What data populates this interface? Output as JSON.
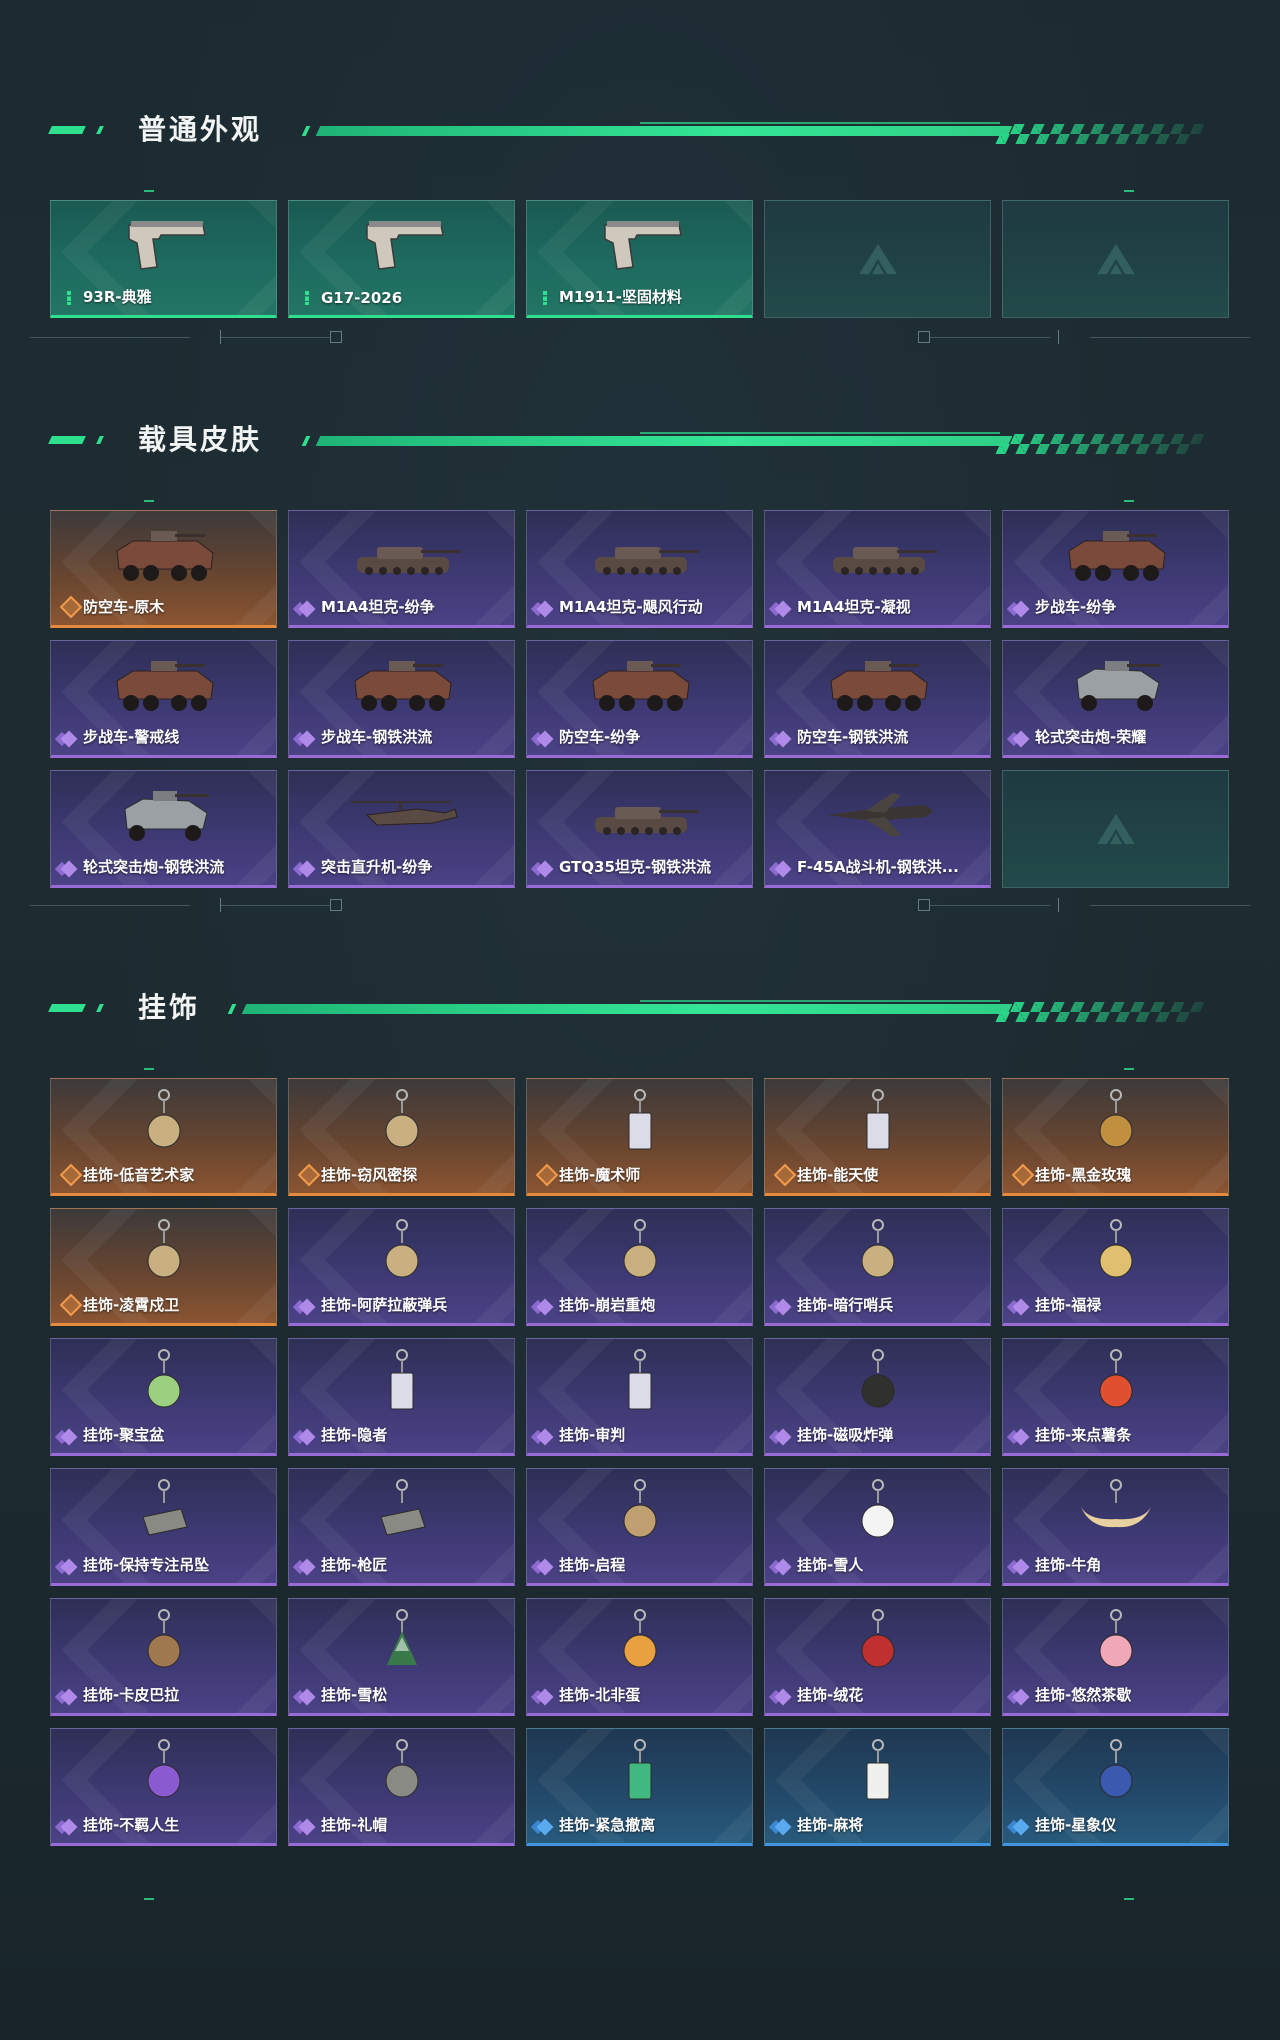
{
  "sections": [
    {
      "title": "普通外观",
      "cards": [
        {
          "label": "93R-典雅",
          "rarity": "green",
          "icon": "pistol-icon"
        },
        {
          "label": "G17-2026",
          "rarity": "green",
          "icon": "pistol-icon"
        },
        {
          "label": "M1911-坚固材料",
          "rarity": "green",
          "icon": "pistol-icon"
        },
        {
          "label": "",
          "rarity": "empty",
          "icon": "logo-placeholder-icon"
        },
        {
          "label": "",
          "rarity": "empty",
          "icon": "logo-placeholder-icon"
        }
      ]
    },
    {
      "title": "载具皮肤",
      "cards": [
        {
          "label": "防空车-原木",
          "rarity": "orange",
          "icon": "armored-vehicle-icon"
        },
        {
          "label": "M1A4坦克-纷争",
          "rarity": "purple",
          "icon": "tank-icon"
        },
        {
          "label": "M1A4坦克-飓风行动",
          "rarity": "purple",
          "icon": "tank-icon"
        },
        {
          "label": "M1A4坦克-凝视",
          "rarity": "purple",
          "icon": "tank-icon"
        },
        {
          "label": "步战车-纷争",
          "rarity": "purple",
          "icon": "armored-vehicle-icon"
        },
        {
          "label": "步战车-警戒线",
          "rarity": "purple",
          "icon": "armored-vehicle-icon"
        },
        {
          "label": "步战车-钢铁洪流",
          "rarity": "purple",
          "icon": "armored-vehicle-icon"
        },
        {
          "label": "防空车-纷争",
          "rarity": "purple",
          "icon": "armored-vehicle-icon"
        },
        {
          "label": "防空车-钢铁洪流",
          "rarity": "purple",
          "icon": "armored-vehicle-icon"
        },
        {
          "label": "轮式突击炮-荣耀",
          "rarity": "purple",
          "icon": "assault-vehicle-icon"
        },
        {
          "label": "轮式突击炮-钢铁洪流",
          "rarity": "purple",
          "icon": "assault-vehicle-icon"
        },
        {
          "label": "突击直升机-纷争",
          "rarity": "purple",
          "icon": "helicopter-icon"
        },
        {
          "label": "GTQ35坦克-钢铁洪流",
          "rarity": "purple",
          "icon": "tank-icon"
        },
        {
          "label": "F-45A战斗机-钢铁洪...",
          "rarity": "purple",
          "icon": "fighter-jet-icon"
        },
        {
          "label": "",
          "rarity": "empty",
          "icon": "logo-placeholder-icon"
        }
      ]
    },
    {
      "title": "挂饰",
      "cards": [
        {
          "label": "挂饰-低音艺术家",
          "rarity": "orange",
          "icon": "charm-figure-icon"
        },
        {
          "label": "挂饰-窃风密探",
          "rarity": "orange",
          "icon": "charm-figure-icon"
        },
        {
          "label": "挂饰-魔术师",
          "rarity": "orange",
          "icon": "charm-card-icon"
        },
        {
          "label": "挂饰-能天使",
          "rarity": "orange",
          "icon": "charm-card-icon"
        },
        {
          "label": "挂饰-黑金玫瑰",
          "rarity": "orange",
          "icon": "charm-rose-icon"
        },
        {
          "label": "挂饰-凌霄戍卫",
          "rarity": "orange",
          "icon": "charm-figure-icon"
        },
        {
          "label": "挂饰-阿萨拉蔽弹兵",
          "rarity": "purple",
          "icon": "charm-figure-icon"
        },
        {
          "label": "挂饰-崩岩重炮",
          "rarity": "purple",
          "icon": "charm-figure-icon"
        },
        {
          "label": "挂饰-暗行哨兵",
          "rarity": "purple",
          "icon": "charm-figure-icon"
        },
        {
          "label": "挂饰-福禄",
          "rarity": "purple",
          "icon": "charm-gourd-icon"
        },
        {
          "label": "挂饰-聚宝盆",
          "rarity": "purple",
          "icon": "charm-bowl-icon"
        },
        {
          "label": "挂饰-隐者",
          "rarity": "purple",
          "icon": "charm-card-icon"
        },
        {
          "label": "挂饰-审判",
          "rarity": "purple",
          "icon": "charm-card-icon"
        },
        {
          "label": "挂饰-磁吸炸弹",
          "rarity": "purple",
          "icon": "charm-bomb-icon"
        },
        {
          "label": "挂饰-来点薯条",
          "rarity": "purple",
          "icon": "charm-fries-icon"
        },
        {
          "label": "挂饰-保持专注吊坠",
          "rarity": "purple",
          "icon": "charm-tag-icon"
        },
        {
          "label": "挂饰-枪匠",
          "rarity": "purple",
          "icon": "charm-tag-icon"
        },
        {
          "label": "挂饰-启程",
          "rarity": "purple",
          "icon": "charm-medal-icon"
        },
        {
          "label": "挂饰-雪人",
          "rarity": "purple",
          "icon": "charm-snowman-icon"
        },
        {
          "label": "挂饰-牛角",
          "rarity": "purple",
          "icon": "charm-horns-icon"
        },
        {
          "label": "挂饰-卡皮巴拉",
          "rarity": "purple",
          "icon": "charm-capybara-icon"
        },
        {
          "label": "挂饰-雪松",
          "rarity": "purple",
          "icon": "charm-tree-icon"
        },
        {
          "label": "挂饰-北非蛋",
          "rarity": "purple",
          "icon": "charm-egg-icon"
        },
        {
          "label": "挂饰-绒花",
          "rarity": "purple",
          "icon": "charm-flower-icon"
        },
        {
          "label": "挂饰-悠然茶歇",
          "rarity": "purple",
          "icon": "charm-cake-icon"
        },
        {
          "label": "挂饰-不羁人生",
          "rarity": "purple",
          "icon": "charm-shoe-icon"
        },
        {
          "label": "挂饰-礼帽",
          "rarity": "purple",
          "icon": "charm-hat-icon"
        },
        {
          "label": "挂饰-紧急撤离",
          "rarity": "blue",
          "icon": "charm-sign-icon"
        },
        {
          "label": "挂饰-麻将",
          "rarity": "blue",
          "icon": "charm-mahjong-icon"
        },
        {
          "label": "挂饰-星象仪",
          "rarity": "blue",
          "icon": "charm-orb-icon"
        }
      ]
    }
  ],
  "colors": {
    "accent": "#2fe08e",
    "green": "#2fe08e",
    "orange": "#e58a3c",
    "purple": "#9a6ad6",
    "blue": "#3f95e0",
    "background": "#1c2a31"
  }
}
